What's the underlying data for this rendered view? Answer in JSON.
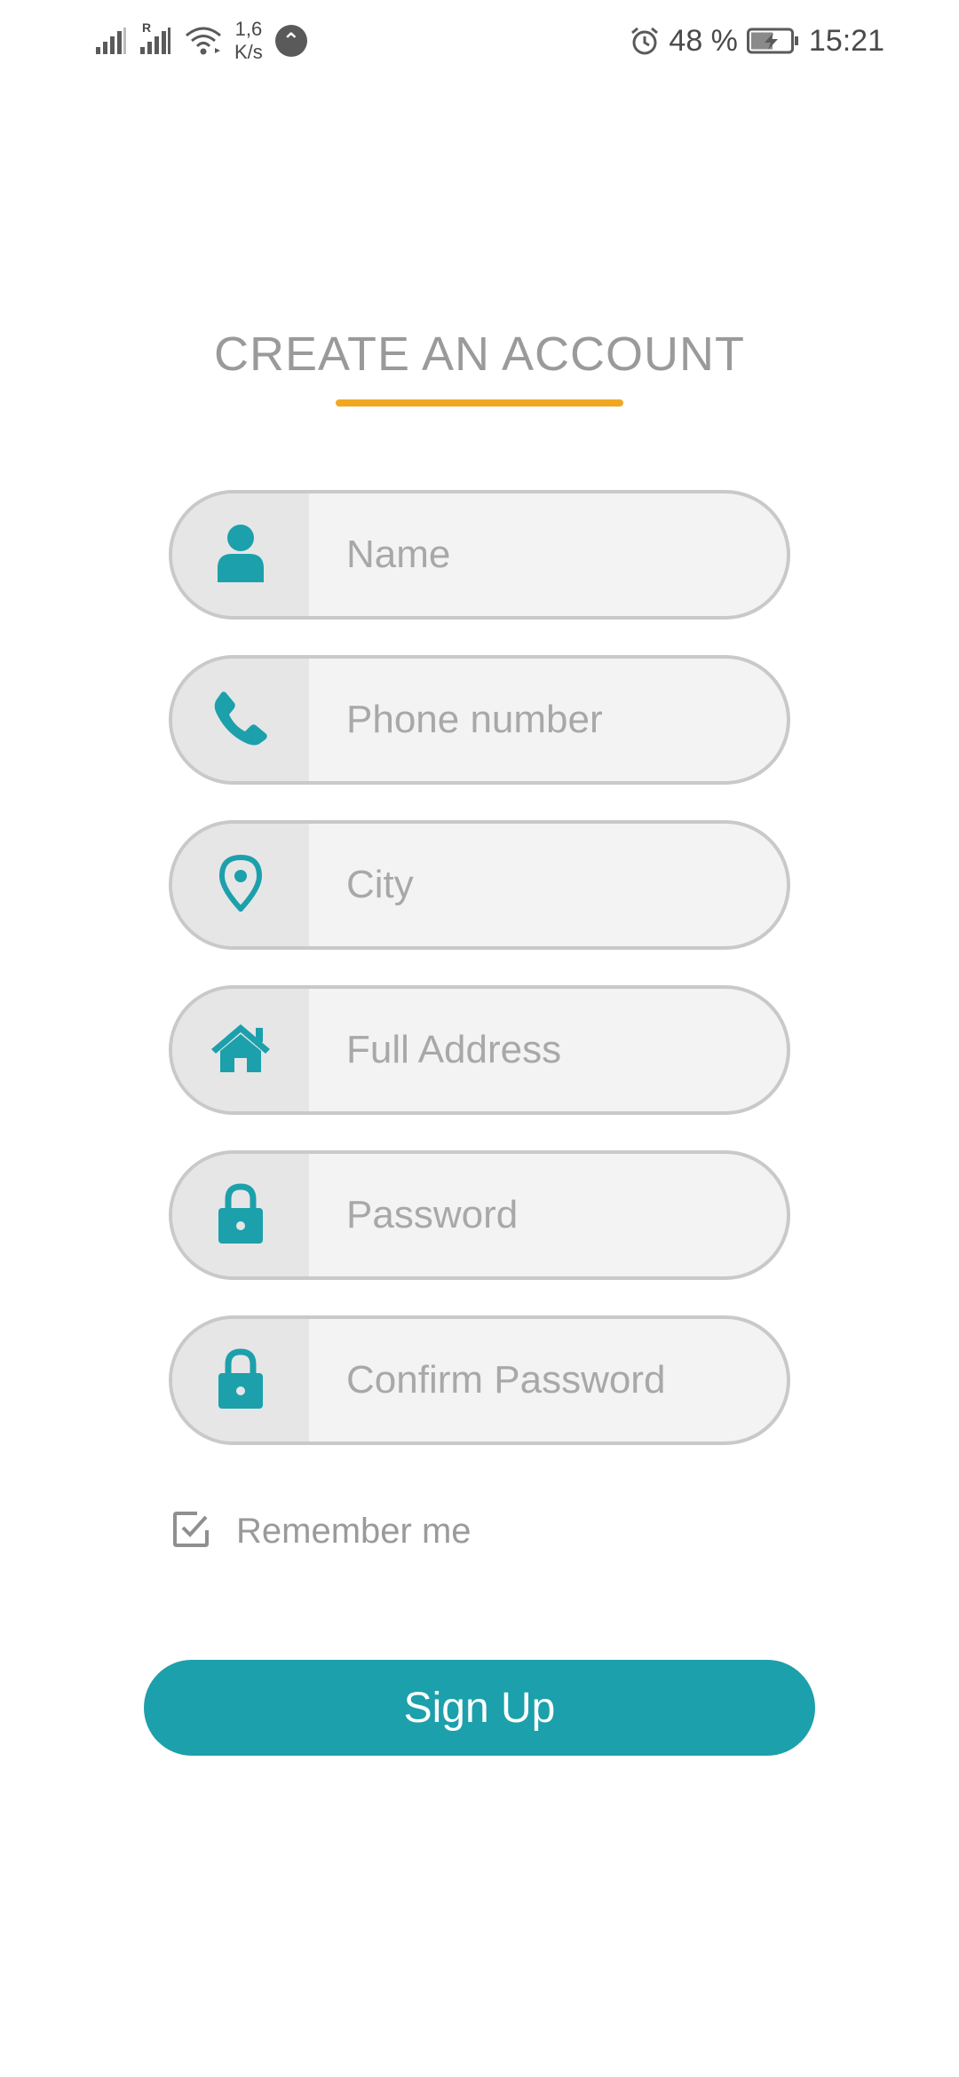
{
  "colors": {
    "accent": "#1ca0ab",
    "underline": "#f0a823",
    "title_text": "#9a9a9a",
    "field_border": "#c9c9c9",
    "field_bg": "#f3f3f3",
    "icon_cell_bg": "#e6e6e6",
    "button_text": "#ffffff"
  },
  "status_bar": {
    "net_speed_value": "1,6",
    "net_speed_unit": "K/s",
    "roaming_label": "R",
    "battery_percent": "48 %",
    "time": "15:21",
    "icons": [
      "signal-icon",
      "signal-roaming-icon",
      "wifi-icon",
      "vpn-icon",
      "alarm-icon",
      "battery-charging-icon"
    ]
  },
  "title": "CREATE AN ACCOUNT",
  "fields": [
    {
      "icon": "person-icon",
      "placeholder": "Name",
      "value": ""
    },
    {
      "icon": "phone-icon",
      "placeholder": "Phone number",
      "value": ""
    },
    {
      "icon": "location-pin-icon",
      "placeholder": "City",
      "value": ""
    },
    {
      "icon": "home-icon",
      "placeholder": "Full Address",
      "value": ""
    },
    {
      "icon": "lock-icon",
      "placeholder": "Password",
      "value": ""
    },
    {
      "icon": "lock-icon",
      "placeholder": "Confirm Password",
      "value": ""
    }
  ],
  "remember": {
    "label": "Remember me",
    "checked": true
  },
  "signup_button": {
    "label": "Sign Up"
  }
}
